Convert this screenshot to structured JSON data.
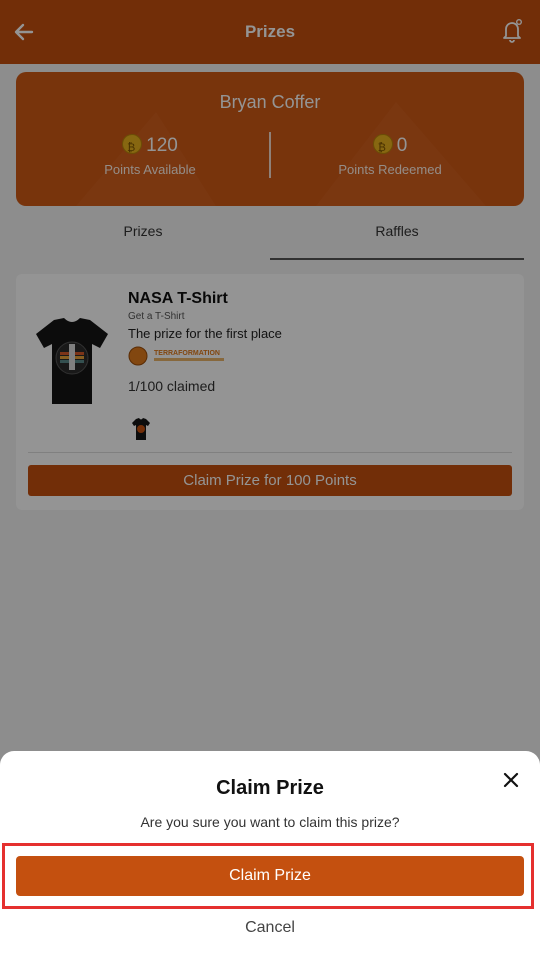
{
  "header": {
    "title": "Prizes"
  },
  "profile": {
    "name": "Bryan Coffer",
    "points_available": "120",
    "points_available_label": "Points Available",
    "points_redeemed": "0",
    "points_redeemed_label": "Points Redeemed"
  },
  "tabs": [
    {
      "label": "Prizes"
    },
    {
      "label": "Raffles"
    }
  ],
  "prize": {
    "name": "NASA T-Shirt",
    "subtitle": "Get a T-Shirt",
    "description": "The prize for the first place",
    "brand": "TERRAFORMATION",
    "claimed": "1/100 claimed",
    "claim_button": "Claim Prize for 100 Points"
  },
  "dialog": {
    "title": "Claim Prize",
    "message": "Are you sure you want to claim this prize?",
    "confirm": "Claim Prize",
    "cancel": "Cancel"
  },
  "colors": {
    "brand": "#c4500f",
    "highlight": "#e5302f"
  }
}
